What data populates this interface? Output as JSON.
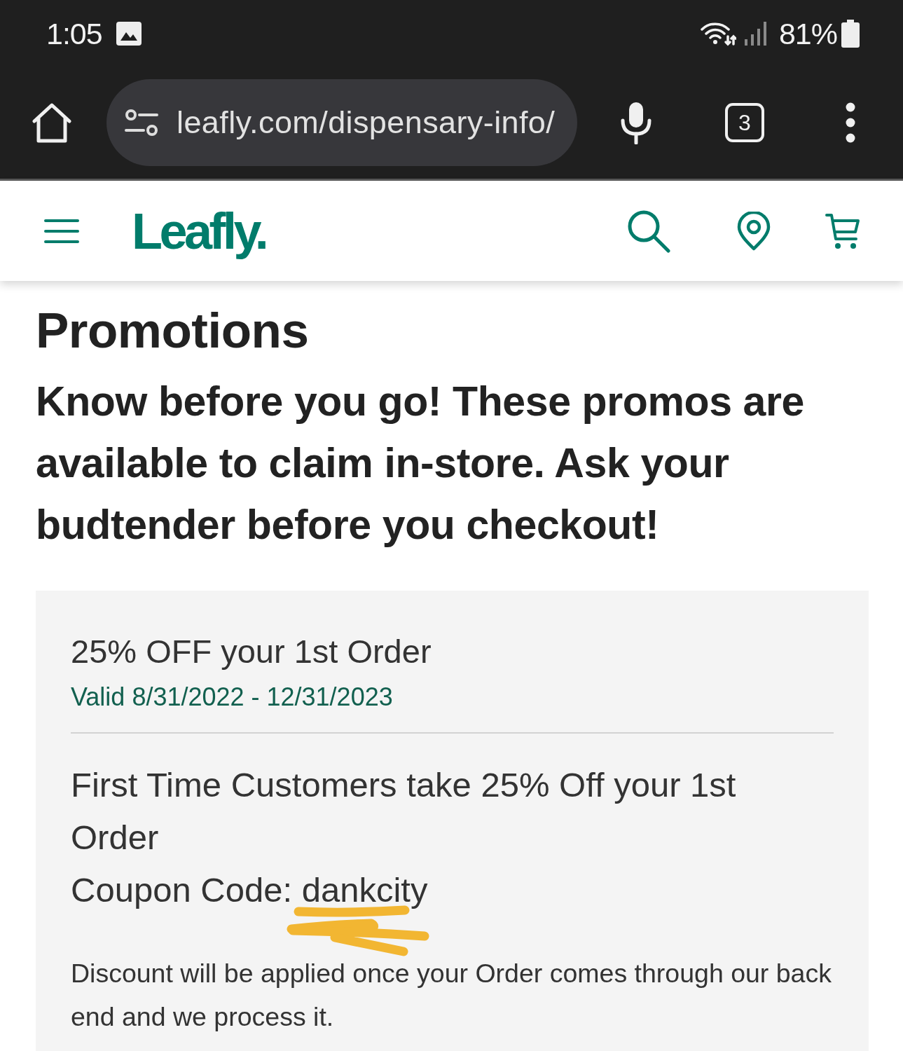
{
  "status_bar": {
    "time": "1:05",
    "battery": "81%"
  },
  "browser": {
    "url": "leafly.com/dispensary-info/",
    "tab_count": "3"
  },
  "site_header": {
    "logo": "Leafly."
  },
  "promotions": {
    "title": "Promotions",
    "subtitle": "Know before you go! These promos are available to claim in-store. Ask your budtender before you checkout!"
  },
  "promo_card": {
    "title": "25% OFF your 1st Order",
    "validity": "Valid 8/31/2022 - 12/31/2023",
    "description_lines": [
      "First Time Customers take 25% Off your 1st Order",
      "Coupon Code: dankcity"
    ],
    "note": "Discount will be applied once your Order comes through our back end and we process it."
  }
}
